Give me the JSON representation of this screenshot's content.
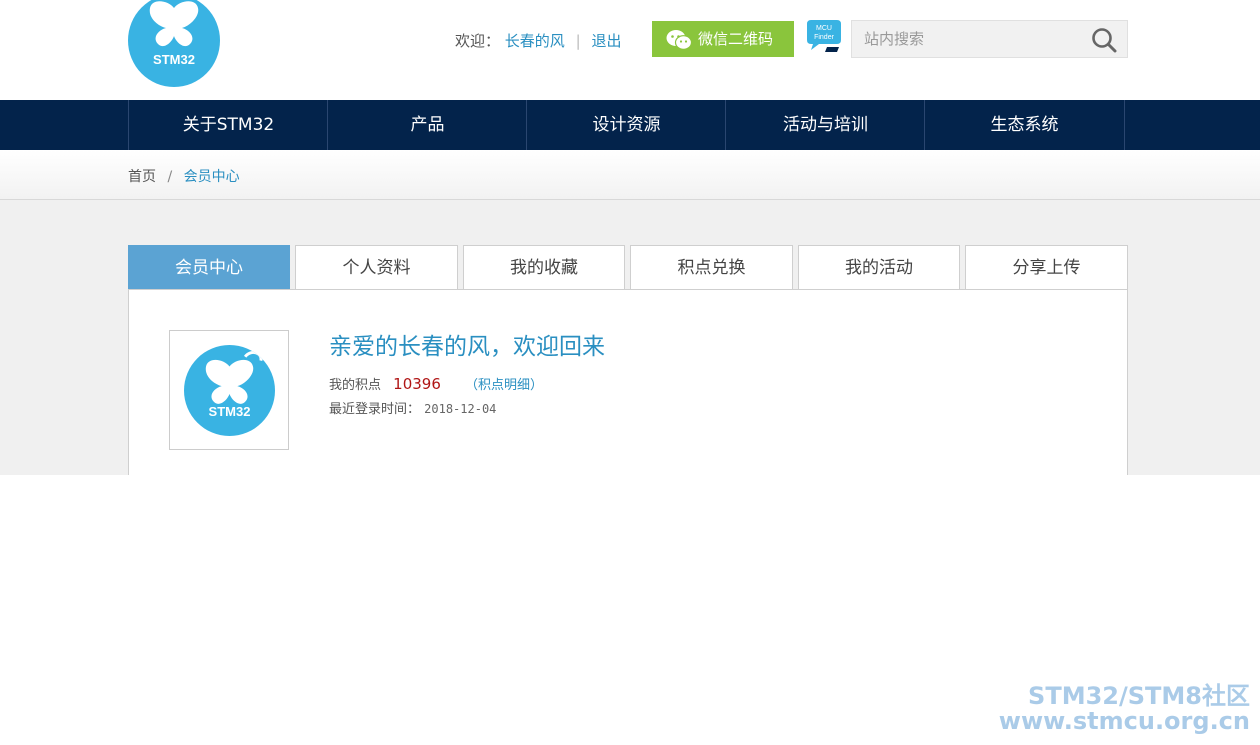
{
  "header": {
    "logo_text": "STM32",
    "welcome_label": "欢迎：",
    "username": "长春的风",
    "logout": "退出",
    "wechat_button": "微信二维码",
    "mcu_finder_line1": "MCU",
    "mcu_finder_line2": "Finder",
    "search_placeholder": "站内搜索"
  },
  "nav": {
    "items": [
      "关于STM32",
      "产品",
      "设计资源",
      "活动与培训",
      "生态系统"
    ]
  },
  "breadcrumb": {
    "home": "首页",
    "separator": "/",
    "current": "会员中心"
  },
  "tabs": {
    "items": [
      "会员中心",
      "个人资料",
      "我的收藏",
      "积点兑换",
      "我的活动",
      "分享上传"
    ],
    "active": "会员中心"
  },
  "profile": {
    "avatar_text": "STM32",
    "greeting": "亲爱的长春的风，欢迎回来",
    "points_label": "我的积点",
    "points_value": "10396",
    "points_detail": "（积点明细）",
    "last_login_label": "最近登录时间：",
    "last_login_date": "2018-12-04"
  },
  "watermark": {
    "line1": "STM32/STM8社区",
    "line2": "www.stmcu.org.cn"
  },
  "colors": {
    "nav_bg": "#03234b",
    "accent_blue": "#2a8fc1",
    "tab_active": "#5ba3d3",
    "wechat_green": "#8ac53c",
    "logo_blue": "#39b3e3",
    "points_red": "#b01616"
  }
}
